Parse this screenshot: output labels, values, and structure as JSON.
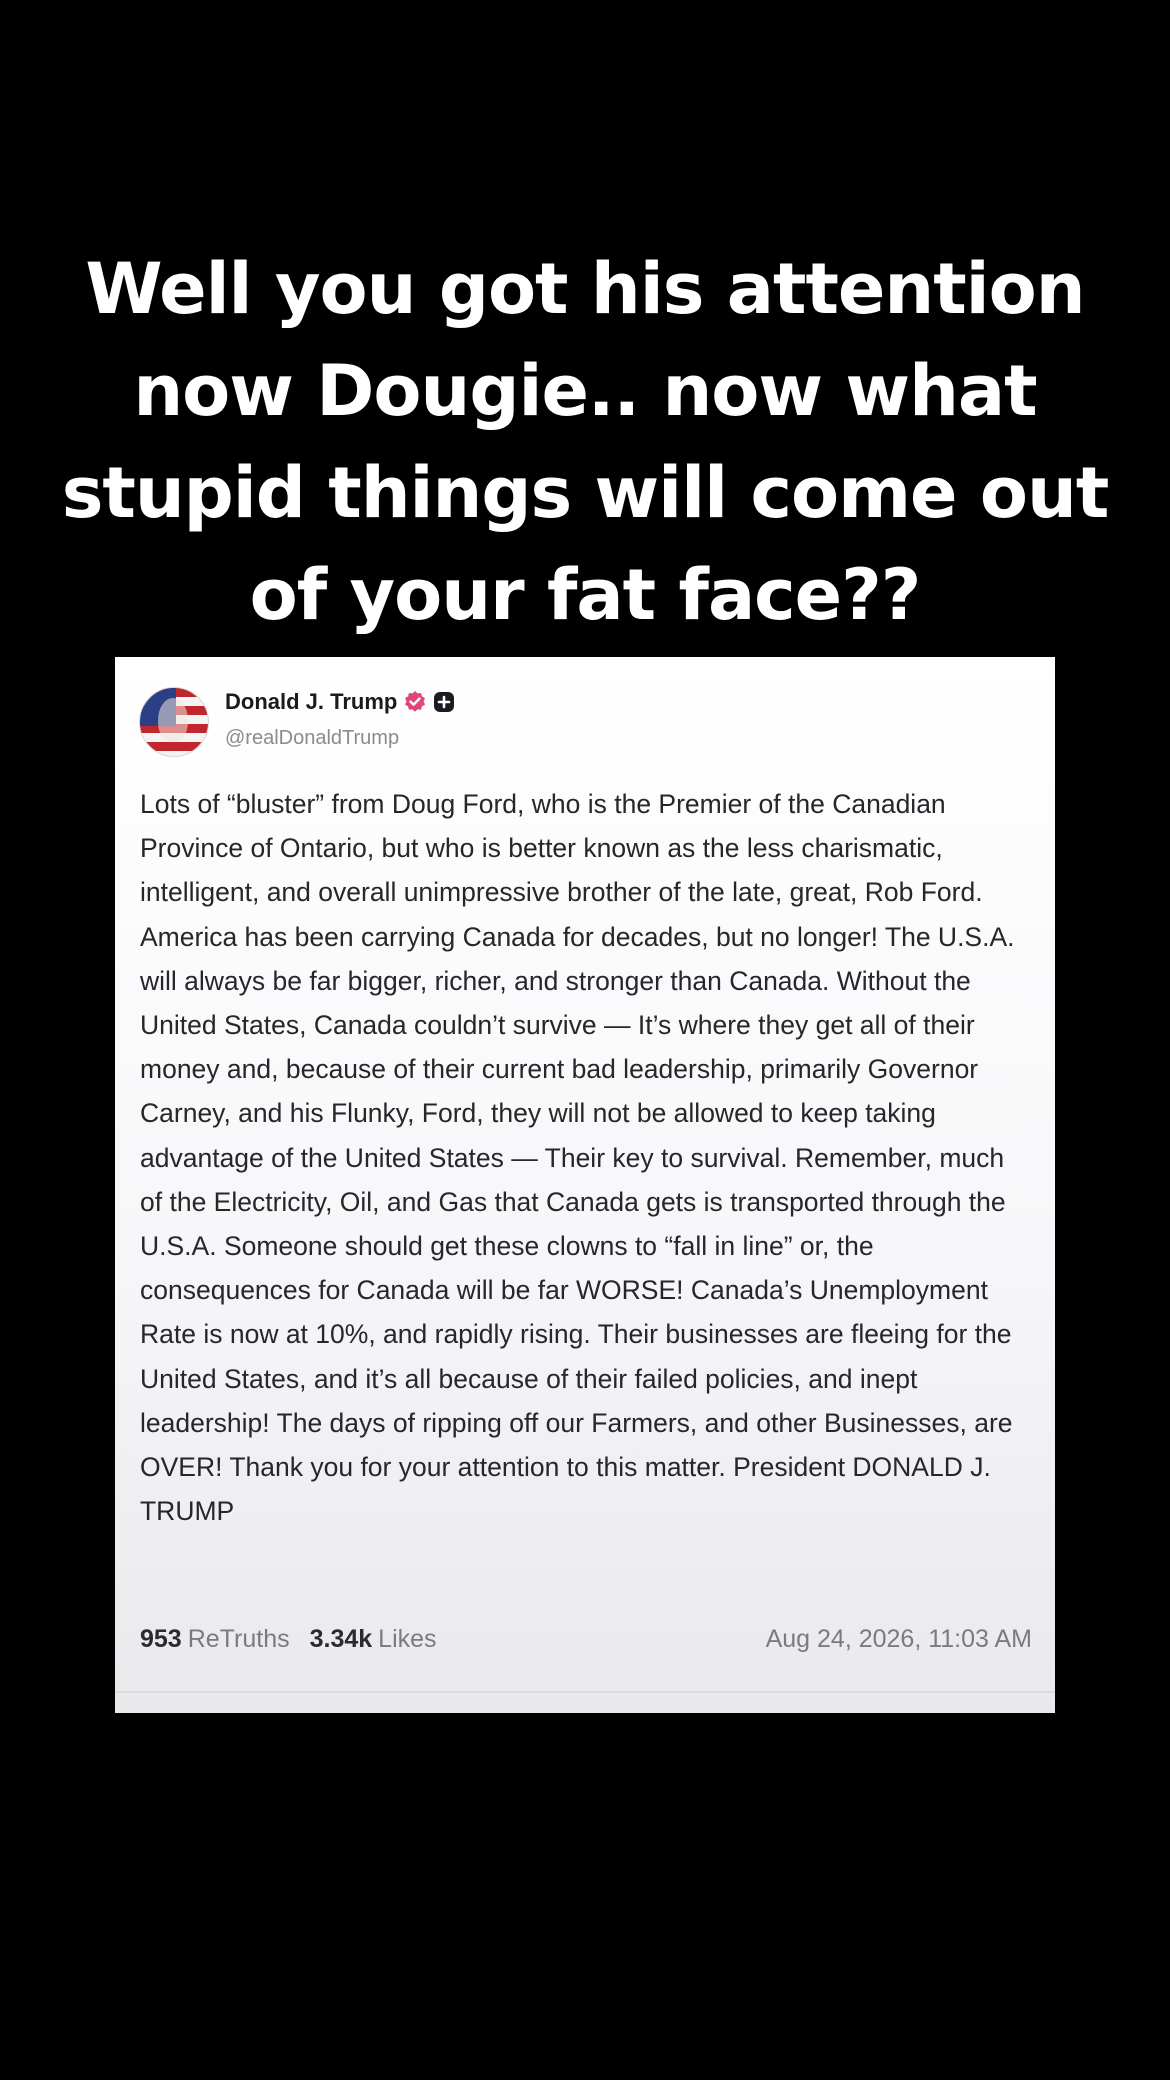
{
  "caption": {
    "text": "Well you got his attention now Dougie.. now what stupid things will come out of your fat face??"
  },
  "post": {
    "author_name": "Donald J. Trump",
    "handle": "@realDonaldTrump",
    "badges": [
      "verified-icon",
      "plus-icon"
    ],
    "body": "Lots of “bluster” from Doug Ford, who is the Premier of the Canadian Province of Ontario, but who is better known as the less charismatic, intelligent, and overall unimpressive brother of the late, great, Rob Ford. America has been carrying Canada for decades, but no longer! The U.S.A. will always be far bigger, richer, and stronger than Canada. Without the United States, Canada couldn’t survive — It’s where they get all of their money and, because of their current bad leadership, primarily Governor Carney, and his Flunky, Ford, they will not be allowed to keep taking advantage of the United States — Their key to survival. Remember, much of the Electricity, Oil, and Gas that Canada gets is transported through the U.S.A. Someone should get these clowns to “fall in line” or, the consequences for Canada will be far WORSE! Canada’s Unemployment Rate is now at 10%, and rapidly rising. Their businesses are fleeing for the United States, and it’s all because of their failed policies, and inept leadership! The days of ripping off our Farmers, and other Businesses, are OVER! Thank you for your attention to this matter. President DONALD J. TRUMP",
    "retruths_count": "953",
    "retruths_label": "ReTruths",
    "likes_count": "3.34k",
    "likes_label": "Likes",
    "timestamp": "Aug 24, 2026, 11:03 AM"
  },
  "colors": {
    "background": "#000000",
    "caption_text": "#ffffff",
    "verified_badge": "#e2457a",
    "card_text": "#26262b"
  }
}
